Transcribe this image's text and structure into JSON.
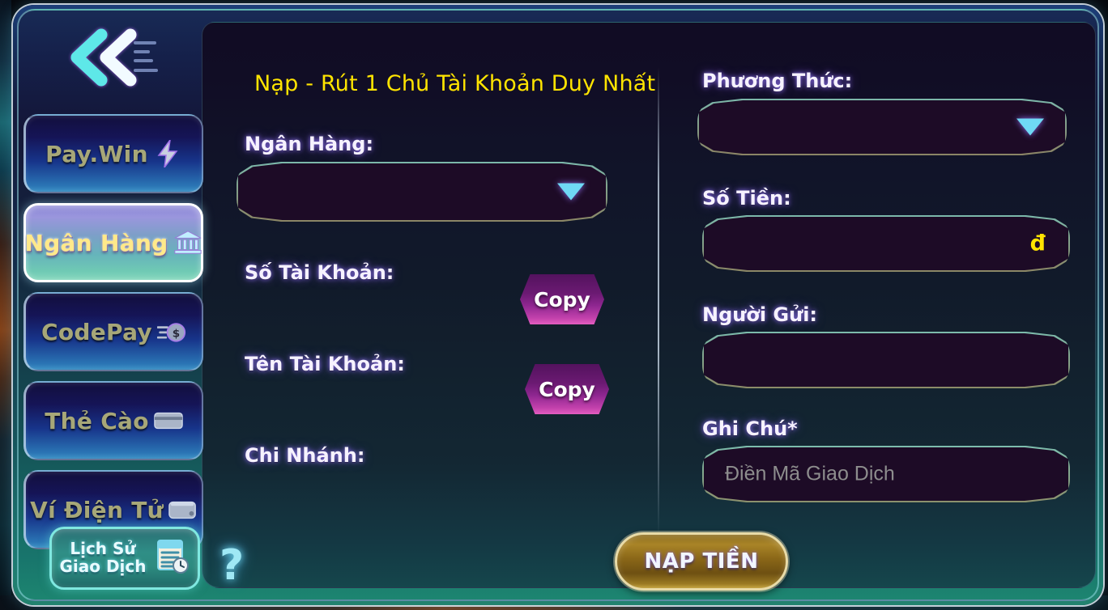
{
  "sidebar": {
    "back_icon": "double-chevron-left-icon",
    "items": [
      {
        "label": "Pay.Win",
        "icon": "lightning-bolt-icon",
        "active": false
      },
      {
        "label": "Ngân Hàng",
        "icon": "bank-icon",
        "active": true
      },
      {
        "label": "CodePay",
        "icon": "coin-dollar-icon",
        "active": false
      },
      {
        "label": "Thẻ Cào",
        "icon": "card-icon",
        "active": false
      },
      {
        "label": "Ví Điện Tử",
        "icon": "wallet-icon",
        "active": false
      }
    ],
    "history_button": {
      "line1": "Lịch Sử",
      "line2": "Giao Dịch",
      "icon": "document-clock-icon"
    }
  },
  "panel": {
    "title": "Nạp - Rút 1 Chủ Tài Khoản Duy Nhất",
    "left_column": {
      "bank_label": "Ngân Hàng:",
      "bank_value": "",
      "bank_caret_icon": "chevron-down-icon",
      "account_number_label": "Số Tài Khoản:",
      "account_number_value": "",
      "account_number_copy": "Copy",
      "account_name_label": "Tên Tài Khoản:",
      "account_name_value": "",
      "account_name_copy": "Copy",
      "branch_label": "Chi Nhánh:",
      "branch_value": ""
    },
    "right_column": {
      "method_label": "Phương Thức:",
      "method_value": "",
      "method_caret_icon": "chevron-down-icon",
      "amount_label": "Số Tiền:",
      "amount_value": "",
      "amount_suffix": "đ",
      "sender_label": "Người Gửi:",
      "sender_value": "",
      "note_label": "Ghi Chú*",
      "note_value": "",
      "note_placeholder": "Điền Mã Giao Dịch"
    },
    "submit_label": "NẠP TIỀN",
    "help_label": "?"
  },
  "colors": {
    "title_yellow": "#ffe400",
    "field_border_mint": "#9fe8d2",
    "field_fill": "#1d0b26",
    "active_nav_text": "#ffe98a",
    "inactive_nav_text": "#a7a778",
    "submit_gold": "#a98427",
    "help_cyan": "#9fe8f5"
  }
}
